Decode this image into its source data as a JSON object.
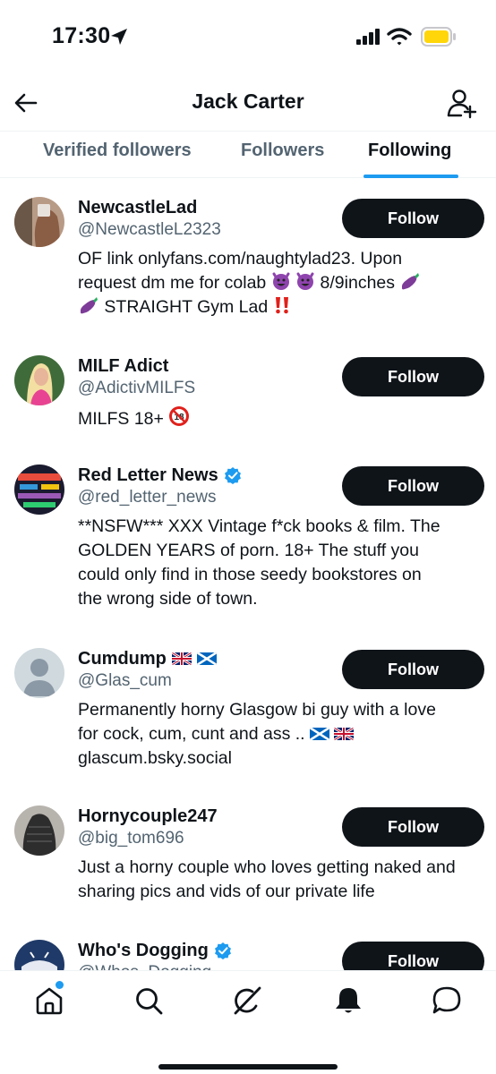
{
  "status_bar": {
    "time": "17:30"
  },
  "header": {
    "title": "Jack Carter"
  },
  "tabs": [
    {
      "label": "Verified followers",
      "active": false
    },
    {
      "label": "Followers",
      "active": false
    },
    {
      "label": "Following",
      "active": true
    }
  ],
  "users": [
    {
      "name": "NewcastleLad",
      "handle": "@NewcastleL2323",
      "verified": false,
      "button": "Follow",
      "bio": [
        "OF link onlyfans.com/naughtylad23. Upon",
        "request dm me for colab",
        "8/9inches",
        "STRAIGHT Gym Lad"
      ]
    },
    {
      "name": "MILF Adict",
      "handle": "@AdictivMILFS",
      "verified": false,
      "button": "Follow",
      "bio": [
        "MILFS 18+"
      ]
    },
    {
      "name": "Red Letter News",
      "handle": "@red_letter_news",
      "verified": true,
      "button": "Follow",
      "bio": [
        "**NSFW*** XXX Vintage f*ck books & film. The",
        "GOLDEN YEARS of porn. 18+ The stuff you",
        "could only find in those seedy bookstores on",
        "the wrong side of town."
      ]
    },
    {
      "name": "Cumdump",
      "handle": "@Glas_cum",
      "verified": false,
      "button": "Follow",
      "bio": [
        "Permanently horny Glasgow bi guy with a love",
        "for cock, cum, cunt and ass ..",
        "glascum.bsky.social"
      ]
    },
    {
      "name": "Hornycouple247",
      "handle": "@big_tom696",
      "verified": false,
      "button": "Follow",
      "bio": [
        "Just a horny couple who loves getting naked and",
        "sharing pics and vids of our private life"
      ]
    },
    {
      "name": "Who's Dogging",
      "handle": "@Whos_Dogging",
      "verified": true,
      "button": "Follow",
      "bio": []
    }
  ],
  "icons": {
    "status": [
      "location-arrow-icon",
      "signal-icon",
      "wifi-icon",
      "battery-icon"
    ],
    "header": [
      "back-arrow-icon",
      "add-user-icon"
    ],
    "nav": [
      "home-icon",
      "search-icon",
      "grok-icon",
      "notifications-icon",
      "messages-icon"
    ]
  },
  "colors": {
    "accent": "#1d9bf0",
    "text": "#0f1419",
    "secondary": "#536471",
    "button": "#0f1419",
    "battery": "#ffd60a"
  }
}
